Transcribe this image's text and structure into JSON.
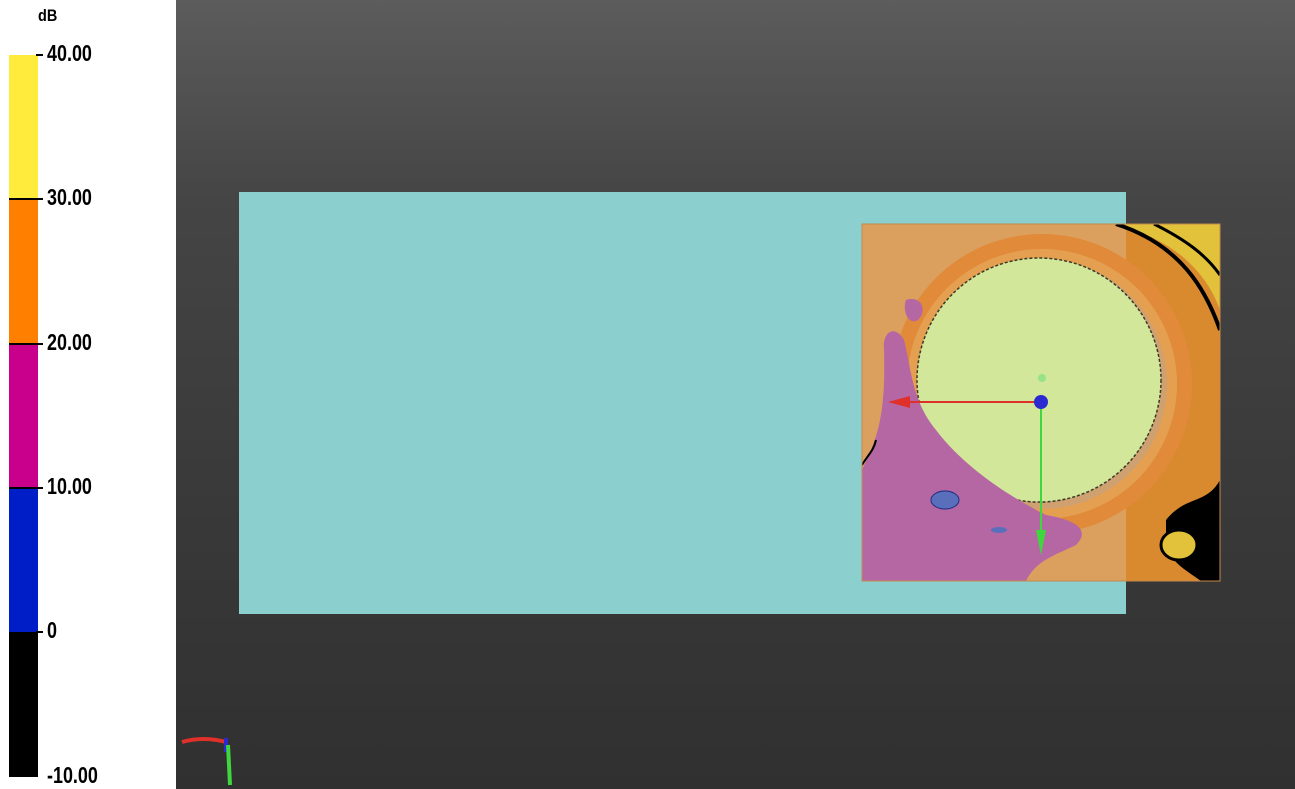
{
  "legend": {
    "unit": "dB",
    "bins": [
      {
        "label": "40.00",
        "color": "#ffeb3b"
      },
      {
        "label": "30.00",
        "color": "#ff7f00"
      },
      {
        "label": "20.00",
        "color": "#c8008c"
      },
      {
        "label": "10.00",
        "color": "#001ec8"
      },
      {
        "label": "0",
        "color": "#000000"
      }
    ],
    "min_label": "-10.00"
  },
  "viewport": {
    "background_top": "#5c5c5c",
    "background_bottom": "#303030",
    "plane_color": "#8ccfcf",
    "axis_colors": {
      "x": "#e0302a",
      "y": "#3ed83e",
      "z": "#2a2ad0"
    },
    "icons": [
      "move-gizmo-icon",
      "orientation-axes-icon"
    ]
  }
}
